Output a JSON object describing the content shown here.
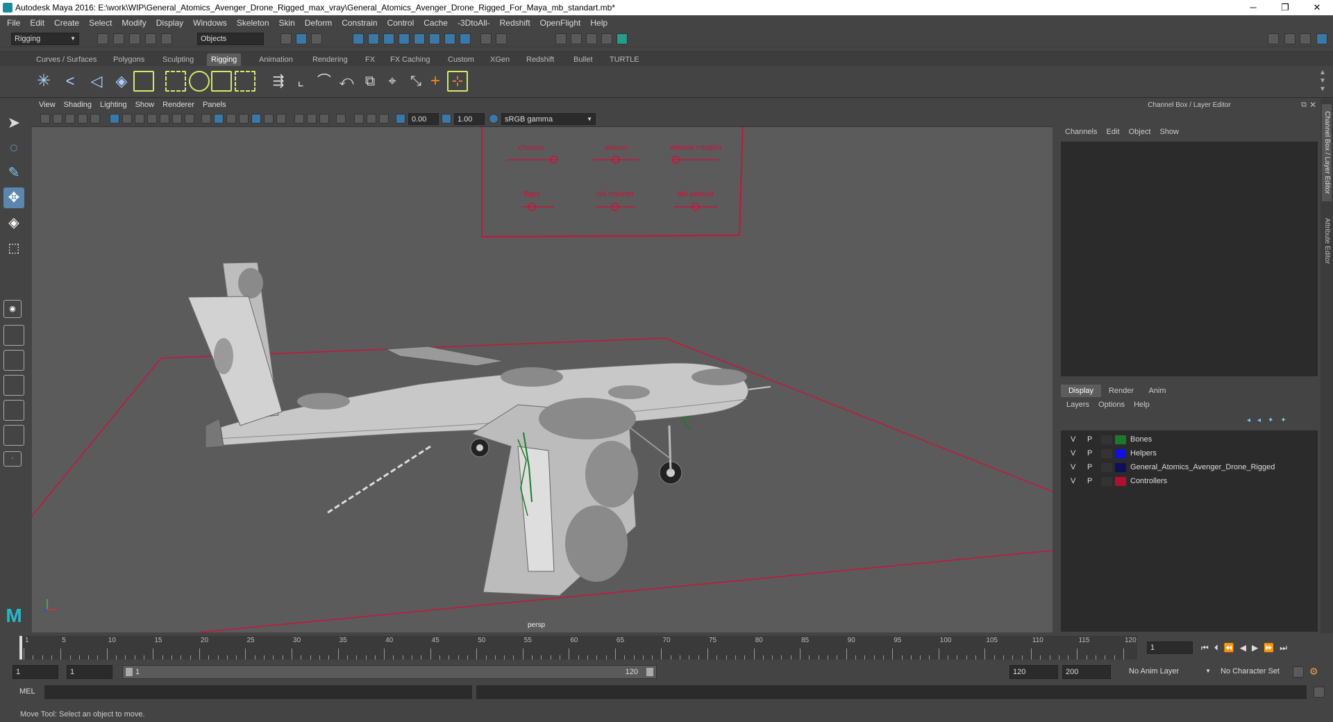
{
  "window": {
    "title": "Autodesk Maya 2016: E:\\work\\WIP\\General_Atomics_Avenger_Drone_Rigged_max_vray\\General_Atomics_Avenger_Drone_Rigged_For_Maya_mb_standart.mb*",
    "minimize": "─",
    "restore": "❐",
    "close": "✕"
  },
  "menubar": [
    "File",
    "Edit",
    "Create",
    "Select",
    "Modify",
    "Display",
    "Windows",
    "Skeleton",
    "Skin",
    "Deform",
    "Constrain",
    "Control",
    "Cache",
    "-3DtoAll-",
    "Redshift",
    "OpenFlight",
    "Help"
  ],
  "status": {
    "menuset": "Rigging",
    "selection_mode": "Objects"
  },
  "shelf_tabs": [
    "Curves / Surfaces",
    "Polygons",
    "Sculpting",
    "Rigging",
    "Animation",
    "Rendering",
    "FX",
    "FX Caching",
    "Custom",
    "XGen",
    "Redshift",
    "Bullet",
    "TURTLE"
  ],
  "active_shelf": "Rigging",
  "viewport": {
    "menu": [
      "View",
      "Shading",
      "Lighting",
      "Show",
      "Renderer",
      "Panels"
    ],
    "near_value": "0.00",
    "far_value": "1.00",
    "color_space": "sRGB gamma",
    "camera_label": "persp",
    "controls": {
      "row1": [
        "chassis",
        "aileron",
        "wheels rotation"
      ],
      "row2": [
        "flaps",
        "tail horizon",
        "tail vertical"
      ]
    },
    "accent_color": "#c8143c"
  },
  "right_panel": {
    "title": "Channel Box / Layer Editor",
    "menu": [
      "Channels",
      "Edit",
      "Object",
      "Show"
    ],
    "layer_tabs": [
      "Display",
      "Render",
      "Anim"
    ],
    "active_layer_tab": "Display",
    "layer_menu": [
      "Layers",
      "Options",
      "Help"
    ],
    "layers": [
      {
        "v": "V",
        "p": "P",
        "name": "Bones",
        "color": "#1a7a2a"
      },
      {
        "v": "V",
        "p": "P",
        "name": "Helpers",
        "color": "#1010e0"
      },
      {
        "v": "V",
        "p": "P",
        "name": "General_Atomics_Avenger_Drone_Rigged",
        "color": "#10105a"
      },
      {
        "v": "V",
        "p": "P",
        "name": "Controllers",
        "color": "#b01030"
      }
    ]
  },
  "side_tabs": [
    "Channel Box / Layer Editor",
    "Attribute Editor"
  ],
  "timeline": {
    "ticks": [
      "1",
      "5",
      "10",
      "15",
      "20",
      "25",
      "30",
      "35",
      "40",
      "45",
      "50",
      "55",
      "60",
      "65",
      "70",
      "75",
      "80",
      "85",
      "90",
      "95",
      "100",
      "105",
      "110",
      "115",
      "120"
    ],
    "current_frame": "1"
  },
  "range": {
    "start": "1",
    "playback_start": "1",
    "slider_start": "1",
    "slider_end": "120",
    "playback_end": "120",
    "end": "200",
    "anim_layer": "No Anim Layer",
    "character_set": "No Character Set"
  },
  "command": {
    "label": "MEL"
  },
  "help_line": "Move Tool: Select an object to move."
}
